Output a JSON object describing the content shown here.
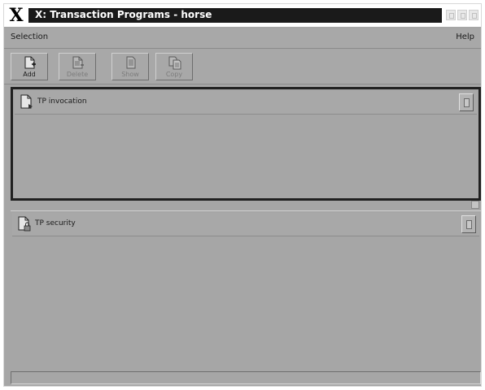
{
  "window": {
    "title": "X: Transaction Programs - horse",
    "logo": "X"
  },
  "menubar": {
    "selection_label": "Selection",
    "help_label": "Help"
  },
  "toolbar": {
    "buttons": [
      {
        "label": "Add",
        "icon": "add-document-icon",
        "enabled": true
      },
      {
        "label": "Delete",
        "icon": "delete-document-icon",
        "enabled": false
      },
      {
        "label": "Show",
        "icon": "show-document-icon",
        "enabled": false
      },
      {
        "label": "Copy",
        "icon": "copy-document-icon",
        "enabled": false
      }
    ]
  },
  "panes": {
    "top": {
      "label": "TP invocation",
      "icon": "tp-invocation-icon"
    },
    "bottom": {
      "label": "TP security",
      "icon": "tp-security-icon"
    }
  },
  "status": {
    "text": ""
  }
}
